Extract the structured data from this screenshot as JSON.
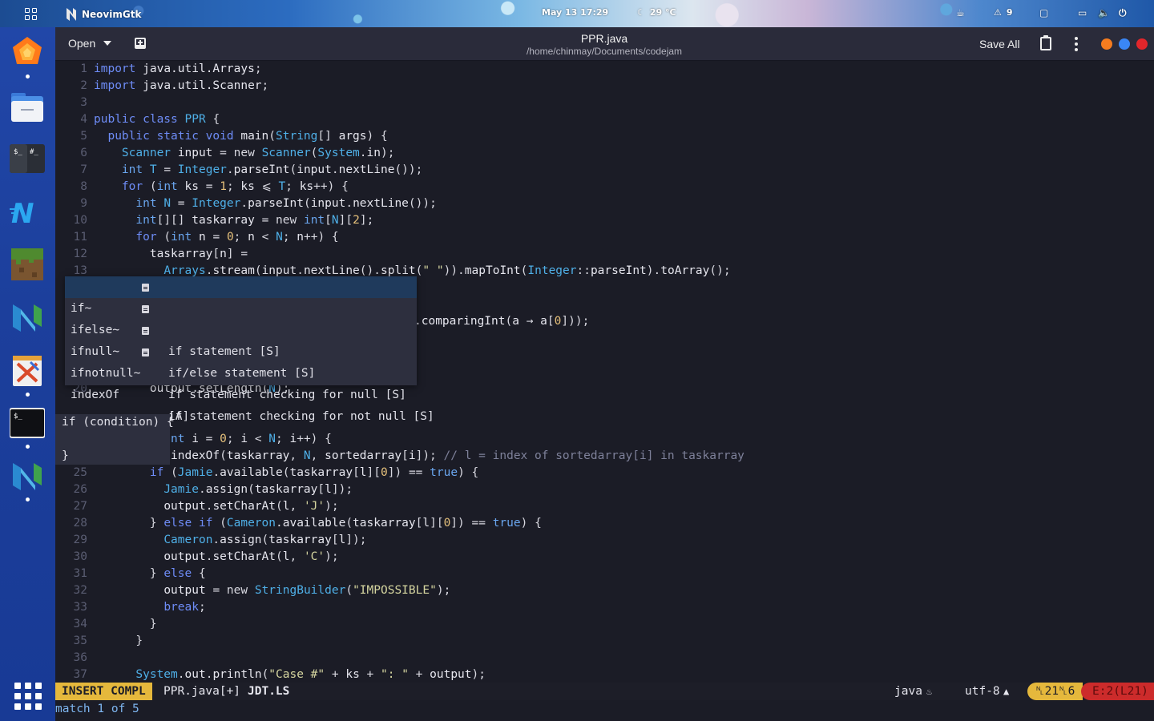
{
  "topbar": {
    "app_name": "NeovimGtk",
    "clock": "May 13  17:29",
    "weather": "29 °C",
    "notification_count": "9"
  },
  "window": {
    "open_label": "Open",
    "title": "PPR.java",
    "subtitle": "/home/chinmay/Documents/codejam",
    "save_all_label": "Save All",
    "colors": {
      "orange": "#f57c1f",
      "blue": "#3a86f5",
      "red": "#e2262b"
    }
  },
  "dock": {
    "apps": [
      "firefox",
      "files",
      "terminal",
      "neovim-gtk-blue",
      "minecraft",
      "neovim",
      "xournal",
      "terminal-2",
      "neovim-2"
    ]
  },
  "editor": {
    "lines": [
      {
        "n": "1",
        "code": "import java.util.Arrays;"
      },
      {
        "n": "2",
        "code": "import java.util.Scanner;"
      },
      {
        "n": "3",
        "code": ""
      },
      {
        "n": "4",
        "code": "public class PPR {"
      },
      {
        "n": "5",
        "code": "  public static void main(String[] args) {"
      },
      {
        "n": "6",
        "code": "    Scanner input = new Scanner(System.in);"
      },
      {
        "n": "7",
        "code": "    int T = Integer.parseInt(input.nextLine());"
      },
      {
        "n": "8",
        "code": "    for (int ks = 1; ks ⩽ T; ks++) {"
      },
      {
        "n": "9",
        "code": "      int N = Integer.parseInt(input.nextLine());"
      },
      {
        "n": "10",
        "code": "      int[][] taskarray = new int[N][2];"
      },
      {
        "n": "11",
        "code": "      for (int n = 0; n < N; n++) {"
      },
      {
        "n": "12",
        "code": "        taskarray[n] ="
      },
      {
        "n": "13",
        "code": "          Arrays.stream(input.nextLine().split(\" \")).mapToInt(Integer::parseInt).toArray();"
      },
      {
        "n": "",
        "code": "                                        .comparingInt(a → a[0]));"
      },
      {
        "n": "20",
        "code": "        output.setLength(N);"
      },
      {
        "n": "21",
        "code": "      if"
      },
      {
        "n": "",
        "code": "nt i = 0; i < N; i++) {"
      },
      {
        "n": "",
        "code": "indexOf(taskarray, N, sortedarray[i]); // l = index of sortedarray[i] in taskarray"
      },
      {
        "n": "25",
        "code": "        if (Jamie.available(taskarray[l][0]) == true) {"
      },
      {
        "n": "26",
        "code": "          Jamie.assign(taskarray[l]);"
      },
      {
        "n": "27",
        "code": "          output.setCharAt(l, 'J');"
      },
      {
        "n": "28",
        "code": "        } else if (Cameron.available(taskarray[l][0]) == true) {"
      },
      {
        "n": "29",
        "code": "          Cameron.assign(taskarray[l]);"
      },
      {
        "n": "30",
        "code": "          output.setCharAt(l, 'C');"
      },
      {
        "n": "31",
        "code": "        } else {"
      },
      {
        "n": "32",
        "code": "          output = new StringBuilder(\"IMPOSSIBLE\");"
      },
      {
        "n": "33",
        "code": "          break;"
      },
      {
        "n": "34",
        "code": "        }"
      },
      {
        "n": "35",
        "code": "      }"
      },
      {
        "n": "36",
        "code": ""
      },
      {
        "n": "37",
        "code": "      System.out.println(\"Case #\" + ks + \": \" + output);"
      }
    ],
    "error_sign": "×…",
    "completion": [
      {
        "abbr": "if~",
        "kind": "snippet",
        "menu": "if statement [S]",
        "selected": true
      },
      {
        "abbr": "ifelse~",
        "kind": "snippet",
        "menu": "if/else statement [S]"
      },
      {
        "abbr": "ifnull~",
        "kind": "snippet",
        "menu": "if statement checking for null [S]"
      },
      {
        "abbr": "ifnotnull~",
        "kind": "snippet",
        "menu": "if statement checking for not null [S]"
      },
      {
        "abbr": "indexOf",
        "kind": "",
        "menu": "[A]"
      }
    ],
    "preview": [
      "if (condition) {",
      "",
      "}"
    ]
  },
  "statusline": {
    "mode": "INSERT COMPL",
    "file": "PPR.java[+]",
    "lsp": "JDT.LS",
    "filetype": "java",
    "encoding": "utf-8",
    "position": "␤21␤6",
    "errors": "E:2(L21)"
  },
  "cmdline": "match 1 of 5"
}
